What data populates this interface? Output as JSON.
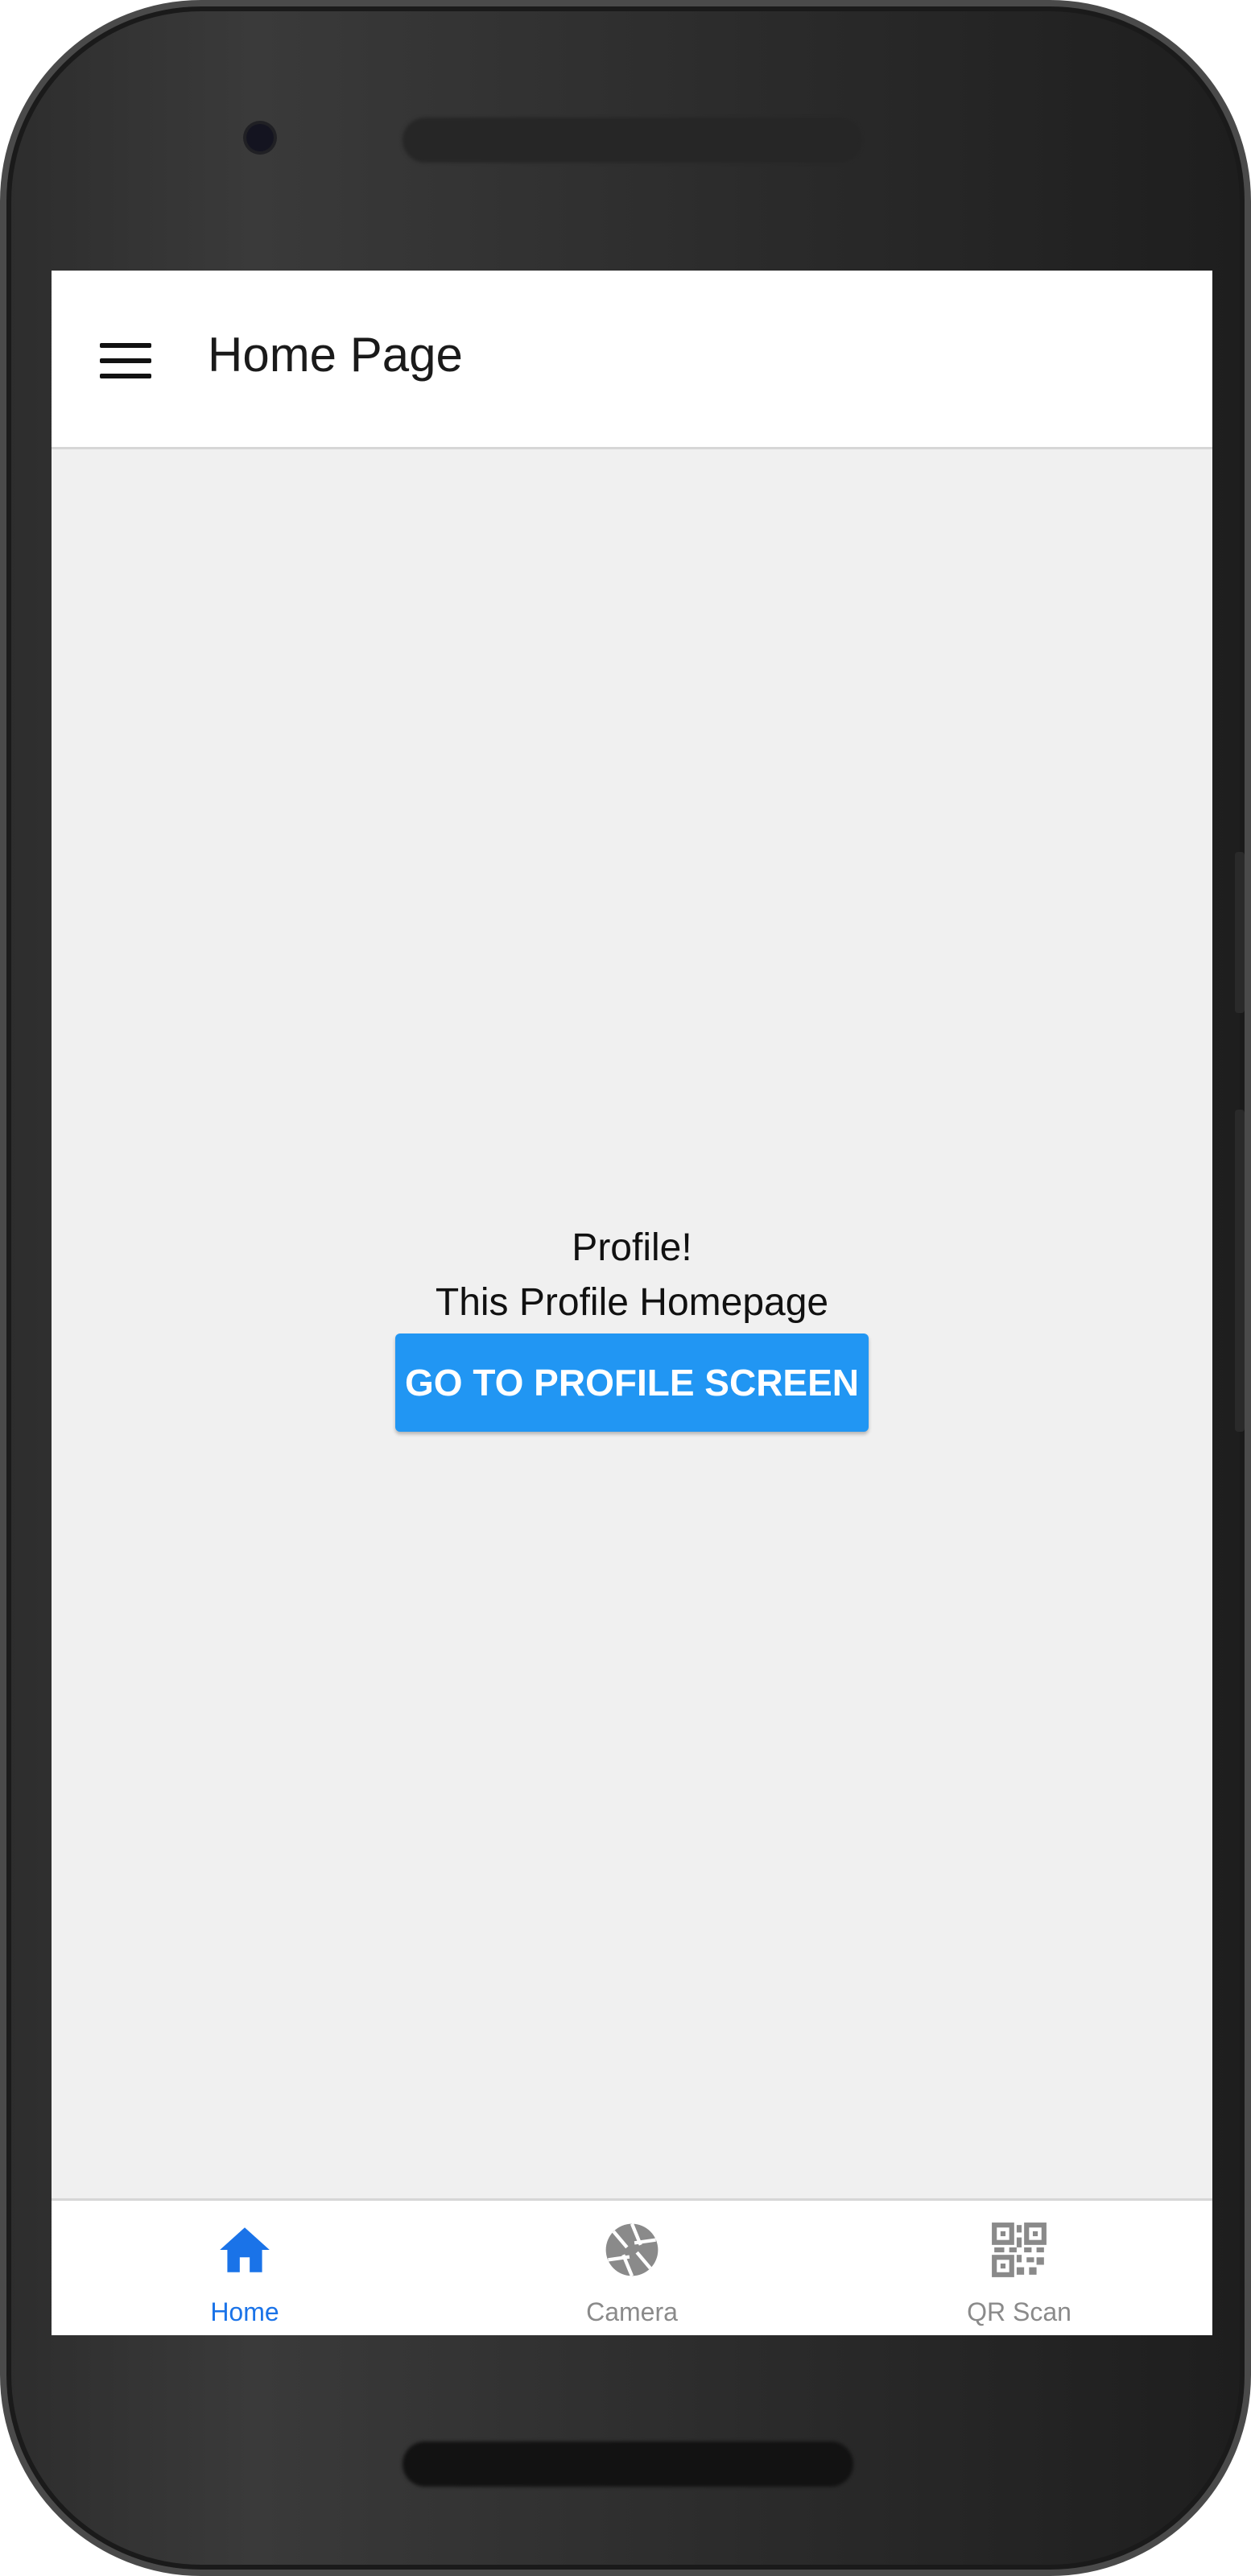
{
  "header": {
    "title": "Home Page",
    "menu_icon": "hamburger-menu-icon"
  },
  "main": {
    "heading": "Profile!",
    "subheading": "This Profile Homepage",
    "button_label": "GO TO PROFILE SCREEN"
  },
  "tabs": [
    {
      "label": "Home",
      "icon": "home-icon",
      "active": true
    },
    {
      "label": "Camera",
      "icon": "camera-aperture-icon",
      "active": false
    },
    {
      "label": "QR Scan",
      "icon": "qr-code-icon",
      "active": false
    }
  ],
  "colors": {
    "accent": "#2196f3",
    "tab_active": "#1a73e8",
    "tab_inactive": "#8a8a8a",
    "screen_bg": "#f0f0f0"
  }
}
